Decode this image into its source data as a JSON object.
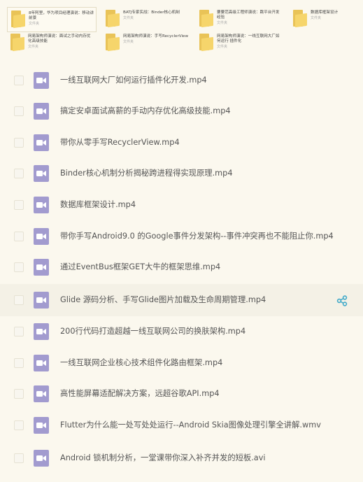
{
  "folders": [
    {
      "name": "8年阿里，华为项目经理演说：移动讲前景",
      "meta": "文件夹"
    },
    {
      "name": "BATJ专家实战：Binder核心机制",
      "meta": "文件夹"
    },
    {
      "name": "要要范高级工程师演说：跳平台开发经验",
      "meta": "文件夹"
    },
    {
      "name": "数据库框架设计",
      "meta": "文件夹"
    },
    {
      "name": "网易架构师演说：面试之手动内存优化高级技能",
      "meta": "文件夹"
    },
    {
      "name": "网易架构师演说：手写RecyclerView",
      "meta": "文件夹"
    },
    {
      "name": "网易架构师演说：一线互联网大厂如何运行 插件化",
      "meta": "文件夹"
    }
  ],
  "files": [
    {
      "name": "一线互联网大厂如何运行插件化开发.mp4"
    },
    {
      "name": "搞定安卓面试高薪的手动内存优化高级技能.mp4"
    },
    {
      "name": "带你从零手写RecyclerView.mp4"
    },
    {
      "name": "Binder核心机制分析揭秘跨进程得实现原理.mp4"
    },
    {
      "name": "数据库框架设计.mp4"
    },
    {
      "name": "带你手写Android9.0 的Google事件分发架构--事件冲突再也不能阻止你.mp4"
    },
    {
      "name": "通过EventBus框架GET大牛的框架思维.mp4"
    },
    {
      "name": "Glide 源码分析、手写Glide图片加载及生命周期管理.mp4"
    },
    {
      "name": "200行代码打造超越一线互联网公司的换肤架构.mp4"
    },
    {
      "name": "一线互联网企业核心技术组件化路由框架.mp4"
    },
    {
      "name": "高性能屏幕适配解决方案，远超谷歌API.mp4"
    },
    {
      "name": "Flutter为什么能一处写处处运行--Android Skia图像处理引擎全讲解.wmv"
    },
    {
      "name": "Android 锁机制分析，一堂课带你深入补齐并发的短板.avi"
    }
  ],
  "colors": {
    "background": "#fbf8ee",
    "video_icon": "#a29bcf",
    "folder": "#f6d56b",
    "share_icon": "#3fa9c9",
    "hover_row": "#f4f1e6"
  },
  "icons": {
    "folder": "folder-icon",
    "video": "video-file-icon",
    "share": "share-icon"
  }
}
